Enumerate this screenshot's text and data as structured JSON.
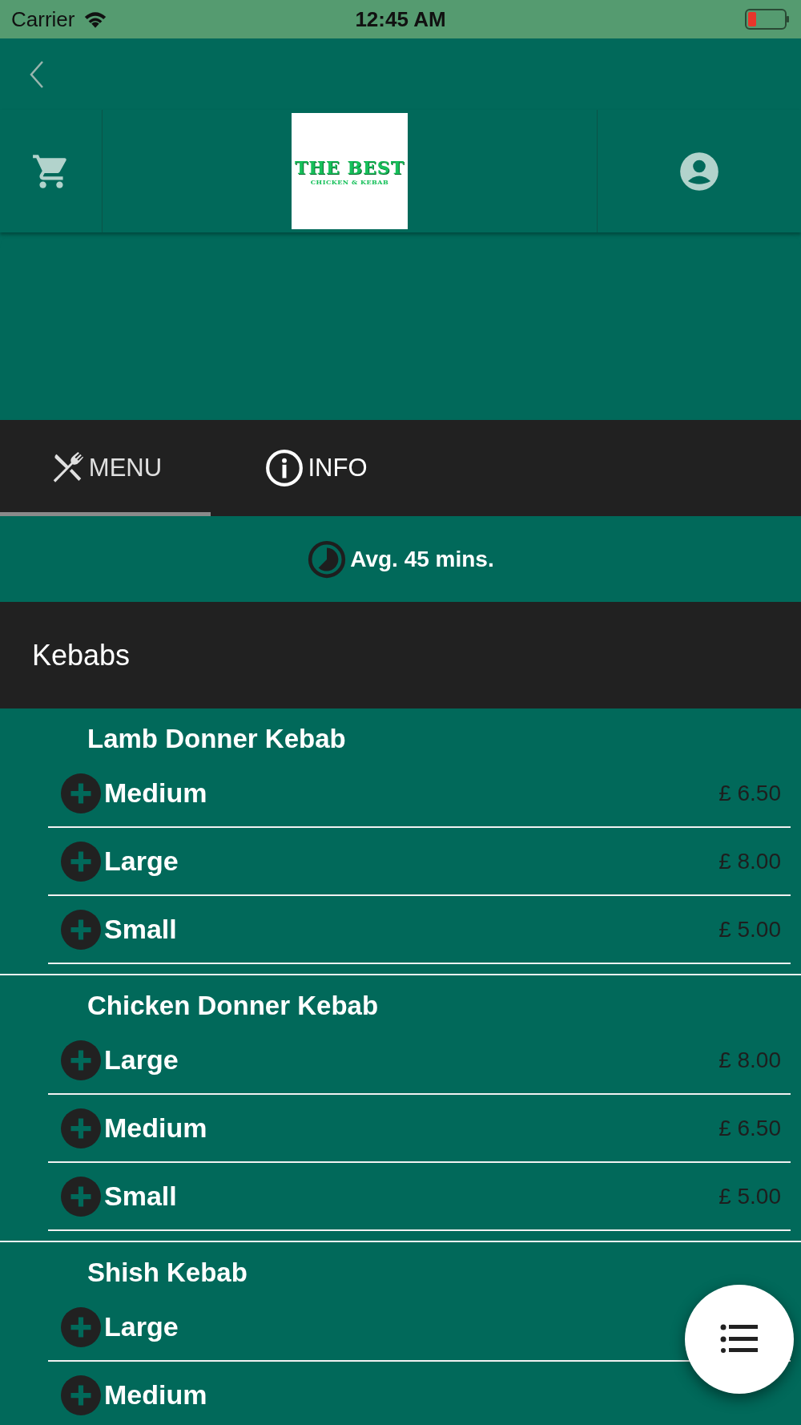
{
  "status_bar": {
    "carrier": "Carrier",
    "time": "12:45 AM"
  },
  "logo": {
    "title": "THE BEST",
    "subtitle": "CHICKEN & KEBAB"
  },
  "tabs": [
    {
      "label": "MENU",
      "kind": "cutlery",
      "selected": true
    },
    {
      "label": "INFO",
      "kind": "info",
      "selected": false
    }
  ],
  "delivery_time": "Avg. 45 mins.",
  "category": "Kebabs",
  "groups": [
    {
      "name": "Lamb Donner Kebab",
      "items": [
        {
          "name": "Medium",
          "price": "£ 6.50"
        },
        {
          "name": "Large",
          "price": "£ 8.00"
        },
        {
          "name": "Small",
          "price": "£ 5.00"
        }
      ]
    },
    {
      "name": "Chicken Donner Kebab",
      "items": [
        {
          "name": "Large",
          "price": "£ 8.00"
        },
        {
          "name": "Medium",
          "price": "£ 6.50"
        },
        {
          "name": "Small",
          "price": "£ 5.00"
        }
      ]
    },
    {
      "name": "Shish Kebab",
      "items": [
        {
          "name": "Large"
        },
        {
          "name": "Medium"
        }
      ]
    }
  ]
}
